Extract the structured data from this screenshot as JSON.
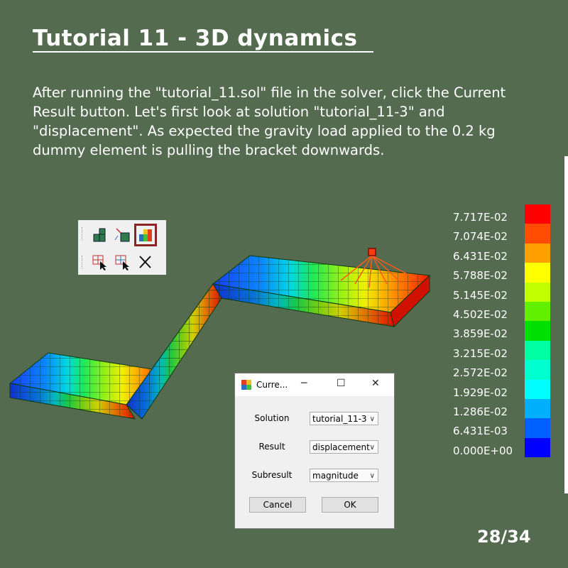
{
  "slide": {
    "title": "Tutorial 11 - 3D dynamics",
    "paragraph": "After running the \"tutorial_11.sol\" file in the solver, click the Current Result button. Let's first look at solution \"tutorial_11-3\" and \"displacement\". As expected the gravity load applied to the 0.2 kg dummy element is pulling the bracket downwards.",
    "page_number": "28/34"
  },
  "legend": {
    "labels": [
      "7.717E-02",
      "7.074E-02",
      "6.431E-02",
      "5.788E-02",
      "5.145E-02",
      "4.502E-02",
      "3.859E-02",
      "3.215E-02",
      "2.572E-02",
      "1.929E-02",
      "1.286E-02",
      "6.431E-03",
      "0.000E+00"
    ],
    "colors": [
      "#ff0000",
      "#ff4c00",
      "#ff9f00",
      "#ffff00",
      "#c0ff00",
      "#60f000",
      "#00e000",
      "#00ffa0",
      "#00ffd0",
      "#00ffff",
      "#00b0ff",
      "#0060ff",
      "#0000ff"
    ]
  },
  "toolbar": {
    "icons": [
      "mesh-view-icon",
      "deformed-mesh-icon",
      "current-result-icon",
      "select-elements-icon",
      "select-nodes-icon",
      "clear-icon"
    ]
  },
  "dialog": {
    "title": "Curre...",
    "solution_label": "Solution",
    "solution_value": "tutorial_11-3",
    "result_label": "Result",
    "result_value": "displacement",
    "subresult_label": "Subresult",
    "subresult_value": "magnitude",
    "cancel_label": "Cancel",
    "ok_label": "OK"
  }
}
